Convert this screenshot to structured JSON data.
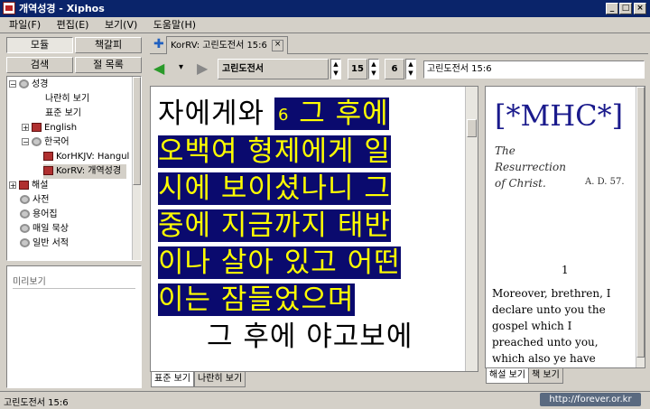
{
  "window": {
    "title": "개역성경 - Xiphos"
  },
  "menu": [
    "파일(F)",
    "편집(E)",
    "보기(V)",
    "도움말(H)"
  ],
  "left_panel": {
    "buttons": [
      "모듈",
      "책갈피",
      "검색",
      "절 목록"
    ],
    "tree": [
      {
        "label": "성경",
        "expander": "⊟",
        "icon": "gear-icon"
      },
      {
        "label": "나란히 보기"
      },
      {
        "label": "표준 보기"
      },
      {
        "label": "English",
        "expander": "⊞",
        "icon": "book-icon"
      },
      {
        "label": "한국어",
        "expander": "⊟",
        "icon": "gear-icon"
      },
      {
        "label": "KorHKJV: Hangul K",
        "icon": "book-icon"
      },
      {
        "label": "KorRV: 개역성경",
        "icon": "book-icon",
        "selected": true
      },
      {
        "label": "해설",
        "expander": "⊞",
        "icon": "book-icon"
      },
      {
        "label": "사전",
        "icon": "gear-icon"
      },
      {
        "label": "용어집",
        "icon": "gear-icon"
      },
      {
        "label": "매일 묵상",
        "icon": "gear-icon"
      },
      {
        "label": "일반 서적",
        "icon": "gear-icon"
      }
    ],
    "preview_title": "미리보기"
  },
  "tab": {
    "label": "KorRV: 고린도전서 15:6"
  },
  "nav": {
    "book": "고린도전서",
    "chapter": "15",
    "verse": "6",
    "reference": "고린도전서 15:6"
  },
  "bible_text": {
    "line0_plain": "자에게와 ",
    "verse_num": "6",
    "line0_hl": " 그 후에",
    "lines": [
      "오백여 형제에게 일",
      "시에 보이셨나니 그",
      "중에 지금까지 태반",
      "이나 살아 있고 어떤",
      "이는 잠들었으며"
    ],
    "trailing": "그 후에 야고보에"
  },
  "bible_tabs": [
    "표준 보기",
    "나란히 보기"
  ],
  "commentary": {
    "heading": "[*MHC*]",
    "subtitle_line1": "The",
    "subtitle_line2": "Resurrection",
    "subtitle_line3": "of Christ.",
    "year": "A. D. 57.",
    "verse_num": "1",
    "lines": [
      "Moreover, brethren, I",
      "declare unto you the",
      "gospel which I",
      "preached unto you,",
      "which also ye have"
    ]
  },
  "commentary_tabs": [
    "해설 보기",
    "책 보기"
  ],
  "status": {
    "text": "고린도전서 15:6",
    "watermark": "http://forever.or.kr"
  }
}
